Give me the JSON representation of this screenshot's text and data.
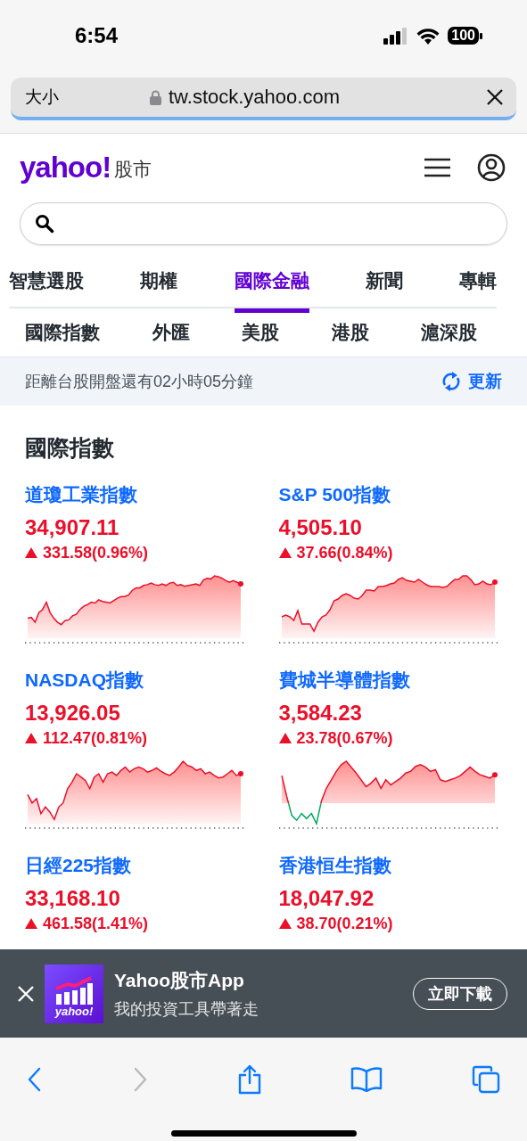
{
  "status_bar": {
    "time": "6:54",
    "battery": "100"
  },
  "url_bar": {
    "text_size": "大小",
    "address": "tw.stock.yahoo.com"
  },
  "header": {
    "logo": "yahoo!",
    "section": "股市"
  },
  "tabs": [
    {
      "label": "智慧選股",
      "selected": false
    },
    {
      "label": "期權",
      "selected": false
    },
    {
      "label": "國際金融",
      "selected": true
    },
    {
      "label": "新聞",
      "selected": false
    },
    {
      "label": "專輯",
      "selected": false
    }
  ],
  "sub_tabs": [
    "國際指數",
    "外匯",
    "美股",
    "港股",
    "滬深股"
  ],
  "notice": {
    "text": "距離台股開盤還有02小時05分鐘",
    "refresh": "更新"
  },
  "section_title": "國際指數",
  "indices": [
    {
      "name": "道瓊工業指數",
      "price": "34,907.11",
      "change": "331.58(0.96%)",
      "rising": true
    },
    {
      "name": "S&P 500指數",
      "price": "4,505.10",
      "change": "37.66(0.84%)",
      "rising": true
    },
    {
      "name": "NASDAQ指數",
      "price": "13,926.05",
      "change": "112.47(0.81%)",
      "rising": true
    },
    {
      "name": "費城半導體指數",
      "price": "3,584.23",
      "change": "23.78(0.67%)",
      "rising": true
    },
    {
      "name": "日經225指數",
      "price": "33,168.10",
      "change": "461.58(1.41%)",
      "rising": true
    },
    {
      "name": "香港恒生指數",
      "price": "18,047.92",
      "change": "38.70(0.21%)",
      "rising": true
    }
  ],
  "app_banner": {
    "icon_text": "yahoo!",
    "title": "Yahoo股市App",
    "subtitle": "我的投資工具帶著走",
    "button": "立即下載"
  }
}
